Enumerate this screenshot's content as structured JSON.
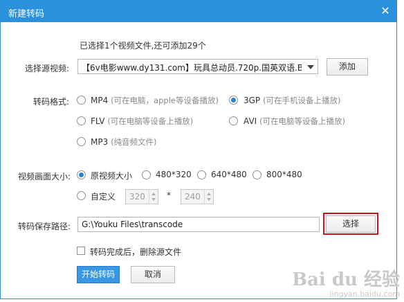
{
  "window": {
    "title": "新建转码",
    "close_symbol": "✕"
  },
  "info": {
    "selected_text": "已选择1个视频文件,还可添加29个"
  },
  "source": {
    "label": "选择源视频:",
    "selected_file": "【6v电影www.dy131.com】玩具总动员.720p.国英双语.B...",
    "add_label": "添加"
  },
  "format": {
    "label": "转码格式:",
    "options": [
      {
        "name": "MP4",
        "hint": "(可在电脑，apple等设备播放)",
        "checked": false
      },
      {
        "name": "3GP",
        "hint": "(可在手机设备上播放)",
        "checked": true
      },
      {
        "name": "FLV",
        "hint": "(可在电脑等设备上播放)",
        "checked": false
      },
      {
        "name": "AVI",
        "hint": "(可在电脑等设备上播放)",
        "checked": false
      },
      {
        "name": "MP3",
        "hint": "(纯音频文件)",
        "checked": false
      }
    ]
  },
  "size": {
    "label": "视频画面大小:",
    "options": [
      {
        "name": "原视频大小",
        "checked": true
      },
      {
        "name": "480*320",
        "checked": false
      },
      {
        "name": "640*480",
        "checked": false
      },
      {
        "name": "800*480",
        "checked": false
      }
    ],
    "custom_label": "自定义",
    "custom_width": "320",
    "custom_height": "240",
    "separator": "*"
  },
  "path": {
    "label": "转码保存路径:",
    "value": "G:\\Youku Files\\transcode",
    "browse_label": "选择"
  },
  "delete_source": {
    "label": "转码完成后，删除源文件",
    "checked": false
  },
  "actions": {
    "start_label": "开始转码",
    "cancel_label": "取消"
  },
  "watermark": {
    "main": "Bai du 经验",
    "sub": "jingyan.baidu.com"
  },
  "colors": {
    "titlebar": "#2a91dd",
    "primary_button": "#3a97e3",
    "highlight_box": "#c8161d"
  }
}
